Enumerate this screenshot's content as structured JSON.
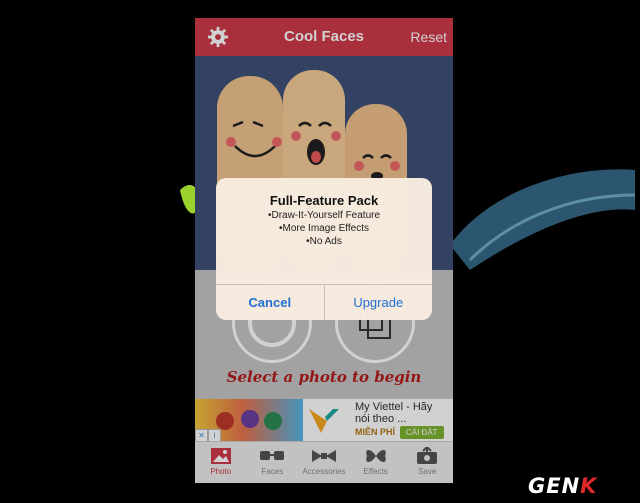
{
  "app": {
    "title": "Cool Faces",
    "reset_label": "Reset",
    "settings_icon": "gear-icon"
  },
  "main": {
    "prompt_text": "Select a photo to begin"
  },
  "ad": {
    "title": "My Viettel - Hãy nói theo ...",
    "free_label": "MIỄN PHÍ",
    "install_label": "CÀI ĐẶT"
  },
  "tabs": [
    {
      "label": "Photo",
      "icon": "photo-icon",
      "active": true
    },
    {
      "label": "Faces",
      "icon": "glasses-icon"
    },
    {
      "label": "Accessories",
      "icon": "bowtie-icon"
    },
    {
      "label": "Effects",
      "icon": "butterfly-icon"
    },
    {
      "label": "Save",
      "icon": "save-icon"
    }
  ],
  "alert": {
    "title": "Full-Feature Pack",
    "lines": [
      "•Draw-It-Yourself Feature",
      "•More Image Effects",
      "•No Ads"
    ],
    "cancel_label": "Cancel",
    "upgrade_label": "Upgrade"
  },
  "watermark": {
    "logo_main": "GEN",
    "logo_accent": "K"
  },
  "colors": {
    "accent": "#cf3a4a",
    "link": "#1f6fd6",
    "prompt": "#b51c1c"
  }
}
